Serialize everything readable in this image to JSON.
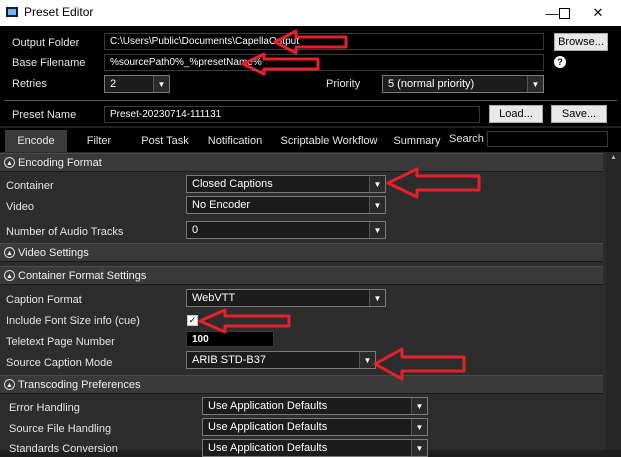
{
  "window": {
    "title": "Preset Editor",
    "minimize": "—",
    "maximize": "☐",
    "close": "✕"
  },
  "top": {
    "output_folder_label": "Output Folder",
    "output_folder_value": "C:\\Users\\Public\\Documents\\CapellaOutput",
    "browse_label": "Browse...",
    "base_filename_label": "Base Filename",
    "base_filename_value": "%sourcePath0%_%presetName%",
    "help_glyph": "?",
    "retries_label": "Retries",
    "retries_value": "2",
    "priority_label": "Priority",
    "priority_value": "5 (normal priority)",
    "preset_name_label": "Preset Name",
    "preset_name_value": "Preset-20230714-111131",
    "load_label": "Load...",
    "save_label": "Save..."
  },
  "tabs": [
    {
      "label": "Encode",
      "active": true
    },
    {
      "label": "Filter"
    },
    {
      "label": "Post Task"
    },
    {
      "label": "Notification"
    },
    {
      "label": "Scriptable Workflow"
    },
    {
      "label": "Summary"
    }
  ],
  "search_label": "Search",
  "sections": {
    "encoding_format": "Encoding Format",
    "video_settings": "Video Settings",
    "container_format_settings": "Container Format Settings",
    "transcoding_preferences": "Transcoding Preferences"
  },
  "encoding": {
    "container_label": "Container",
    "container_value": "Closed Captions",
    "video_label": "Video",
    "video_value": "No Encoder",
    "audio_tracks_label": "Number of Audio Tracks",
    "audio_tracks_value": "0"
  },
  "container_settings": {
    "caption_format_label": "Caption Format",
    "caption_format_value": "WebVTT",
    "font_size_label": "Include Font Size info (cue)",
    "font_size_checked": "✓",
    "teletext_label": "Teletext Page Number",
    "teletext_value": "100",
    "source_caption_label": "Source Caption Mode",
    "source_caption_value": "ARIB STD-B37"
  },
  "transcoding": {
    "error_handling_label": "Error Handling",
    "error_handling_value": "Use Application Defaults",
    "source_file_label": "Source File Handling",
    "source_file_value": "Use Application Defaults",
    "standards_label": "Standards Conversion",
    "standards_value": "Use Application Defaults"
  },
  "colors": {
    "annotation_arrow": "#e8202a",
    "background": "#2d2d2d"
  }
}
